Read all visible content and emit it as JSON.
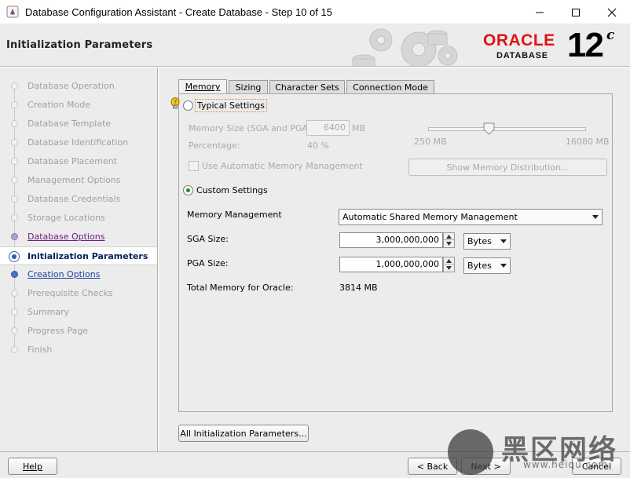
{
  "window": {
    "title": "Database Configuration Assistant - Create Database - Step 10 of 15",
    "minimize_icon": "minimize-icon",
    "maximize_icon": "maximize-icon",
    "close_icon": "close-icon"
  },
  "header": {
    "title": "Initialization Parameters",
    "logo_text": "ORACLE",
    "logo_sub": "DATABASE",
    "version": "12",
    "version_sup": "c",
    "brand_color": "#e0131a"
  },
  "nav": {
    "items": [
      {
        "label": "Database Operation",
        "state": "done"
      },
      {
        "label": "Creation Mode",
        "state": "done"
      },
      {
        "label": "Database Template",
        "state": "done"
      },
      {
        "label": "Database Identification",
        "state": "done"
      },
      {
        "label": "Database Placement",
        "state": "done"
      },
      {
        "label": "Management Options",
        "state": "done"
      },
      {
        "label": "Database Credentials",
        "state": "done"
      },
      {
        "label": "Storage Locations",
        "state": "done"
      },
      {
        "label": "Database Options",
        "state": "visited"
      },
      {
        "label": "Initialization Parameters",
        "state": "current"
      },
      {
        "label": "Creation Options",
        "state": "next"
      },
      {
        "label": "Prerequisite Checks",
        "state": "pending"
      },
      {
        "label": "Summary",
        "state": "pending"
      },
      {
        "label": "Progress Page",
        "state": "pending"
      },
      {
        "label": "Finish",
        "state": "pending"
      }
    ]
  },
  "tabs": [
    {
      "label": "Memory",
      "active": true
    },
    {
      "label": "Sizing",
      "active": false
    },
    {
      "label": "Character Sets",
      "active": false
    },
    {
      "label": "Connection Mode",
      "active": false
    }
  ],
  "memory": {
    "typical_label": "Typical Settings",
    "memory_size_label": "Memory Size (SGA and PGA):",
    "memory_size_value": "6400",
    "memory_size_unit": "MB",
    "percentage_label": "Percentage:",
    "percentage_value": "40 %",
    "slider_min": "250 MB",
    "slider_max": "16080 MB",
    "slider_level_percent": 40,
    "amm_label": "Use Automatic Memory Management",
    "show_distribution_label": "Show Memory Distribution...",
    "custom_label": "Custom Settings",
    "memory_management_label": "Memory Management",
    "memory_management_value": "Automatic Shared Memory Management",
    "sga_label": "SGA Size:",
    "sga_value": "3,000,000,000",
    "sga_unit": "Bytes",
    "pga_label": "PGA Size:",
    "pga_value": "1,000,000,000",
    "pga_unit": "Bytes",
    "total_label": "Total Memory for Oracle:",
    "total_value": "3814 MB",
    "selected_mode": "custom"
  },
  "all_params_label": "All Initialization Parameters...",
  "footer": {
    "help_label": "Help",
    "back_label": "< Back",
    "next_label": "Next >",
    "cancel_label": "Cancel"
  },
  "watermark": {
    "text": "黑区网络",
    "url": "www.heiqu.com"
  }
}
